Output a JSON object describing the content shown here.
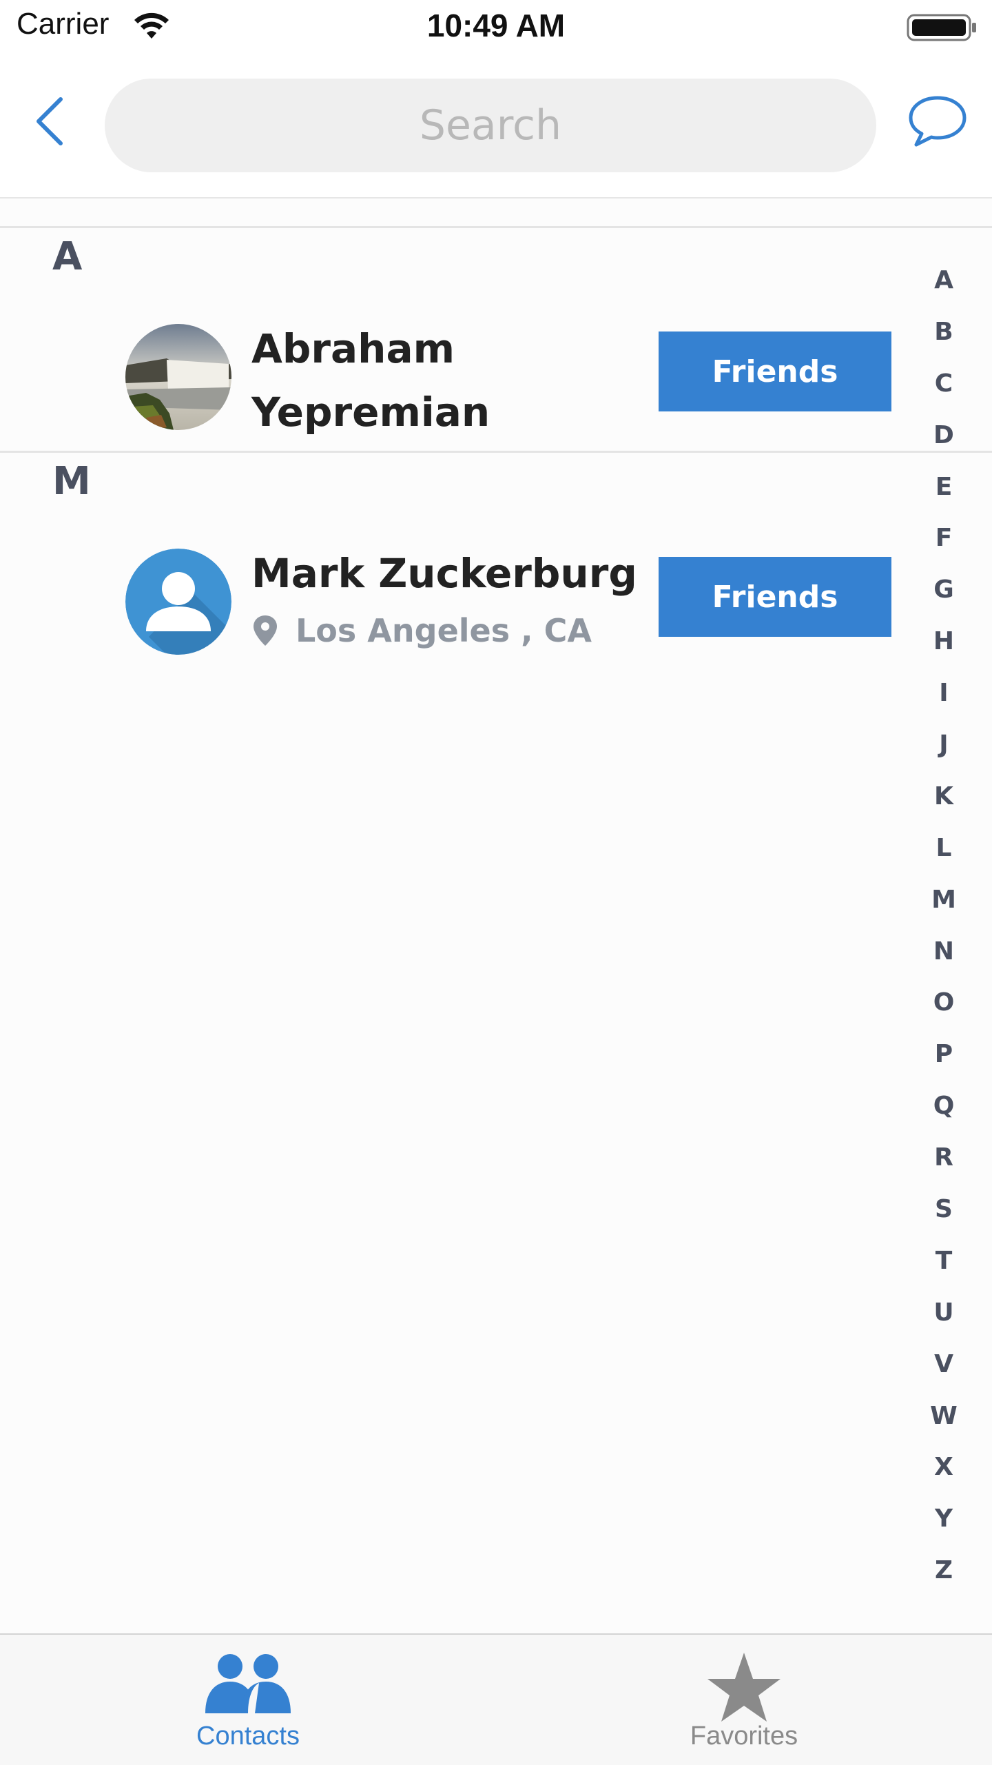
{
  "status_bar": {
    "carrier": "Carrier",
    "time": "10:49 AM"
  },
  "nav": {
    "search_placeholder": "Search"
  },
  "sections": [
    {
      "letter": "A",
      "contact": {
        "name_line1": "Abraham",
        "name_line2": "Yepremian",
        "button": "Friends"
      }
    },
    {
      "letter": "M",
      "contact": {
        "name": "Mark Zuckerburg",
        "location": "Los Angeles , CA",
        "button": "Friends"
      }
    }
  ],
  "index": [
    "A",
    "B",
    "C",
    "D",
    "E",
    "F",
    "G",
    "H",
    "I",
    "J",
    "K",
    "L",
    "M",
    "N",
    "O",
    "P",
    "Q",
    "R",
    "S",
    "T",
    "U",
    "V",
    "W",
    "X",
    "Y",
    "Z"
  ],
  "tabs": [
    {
      "label": "Contacts",
      "icon": "contacts-icon",
      "active": true
    },
    {
      "label": "Favorites",
      "icon": "star-icon",
      "active": false
    }
  ],
  "colors": {
    "accent": "#3581d1",
    "section_header": "#4a5060",
    "location_text": "#8f96a0"
  }
}
